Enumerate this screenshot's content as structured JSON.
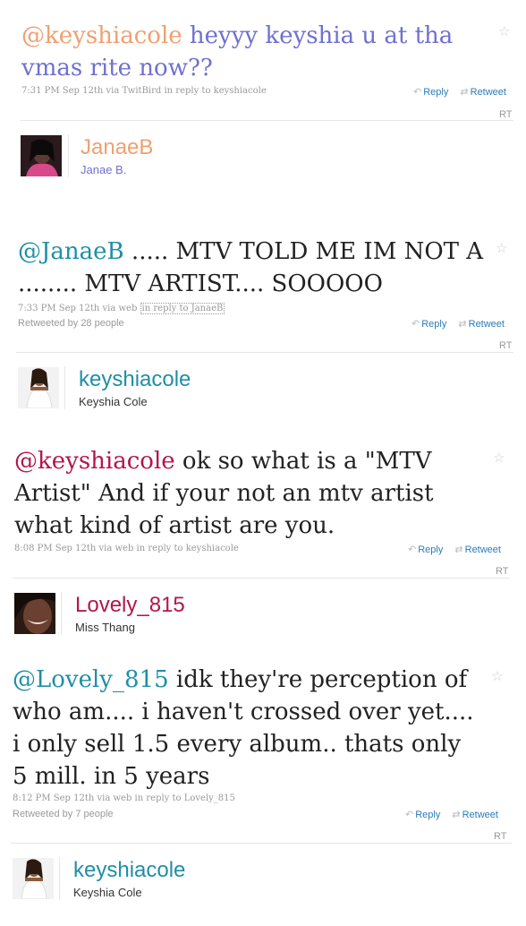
{
  "colors": {
    "mention_teal": "#1f8fa6",
    "mention_orange": "#f0a070",
    "mention_crimson": "#b3164b",
    "link_blue": "#2b7bb9",
    "text_dark": "#222222",
    "text_violet": "#7070d0",
    "meta_gray": "#999999"
  },
  "action_labels": {
    "reply": "Reply",
    "retweet": "Retweet",
    "rt": "RT"
  },
  "tweets": [
    {
      "mention": "@keyshiacole",
      "body": " heyyy keyshia u at tha vmas rite now??",
      "meta_time": "7:31 PM Sep 12th via TwitBird ",
      "meta_reply": "in reply to keyshiacole",
      "retweeted_by": "",
      "author": {
        "username": "JanaeB",
        "fullname": "Janae B."
      }
    },
    {
      "mention": "@JanaeB",
      "body": " ..... MTV TOLD ME IM NOT A ........ MTV ARTIST.... SOOOOO",
      "meta_time": "7:33 PM Sep 12th via web ",
      "meta_reply": "in reply to JanaeB",
      "retweeted_by": "Retweeted by 28 people",
      "author": {
        "username": "keyshiacole",
        "fullname": "Keyshia Cole"
      }
    },
    {
      "mention": "@keyshiacole",
      "body": " ok so what is a \"MTV Artist\" And if your not an mtv artist what kind of artist are you.",
      "meta_time": "8:08 PM Sep 12th via web ",
      "meta_reply": "in reply to keyshiacole",
      "retweeted_by": "",
      "author": {
        "username": "Lovely_815",
        "fullname": "Miss Thang"
      }
    },
    {
      "mention": "@Lovely_815",
      "body": " idk they're perception of who am.... i haven't crossed over yet.... i only sell 1.5 every album.. thats only 5 mill. in 5 years",
      "meta_time": "8:12 PM Sep 12th via web ",
      "meta_reply": "in reply to Lovely_815",
      "retweeted_by": "Retweeted by 7 people",
      "author": {
        "username": "keyshiacole",
        "fullname": "Keyshia Cole"
      }
    }
  ]
}
